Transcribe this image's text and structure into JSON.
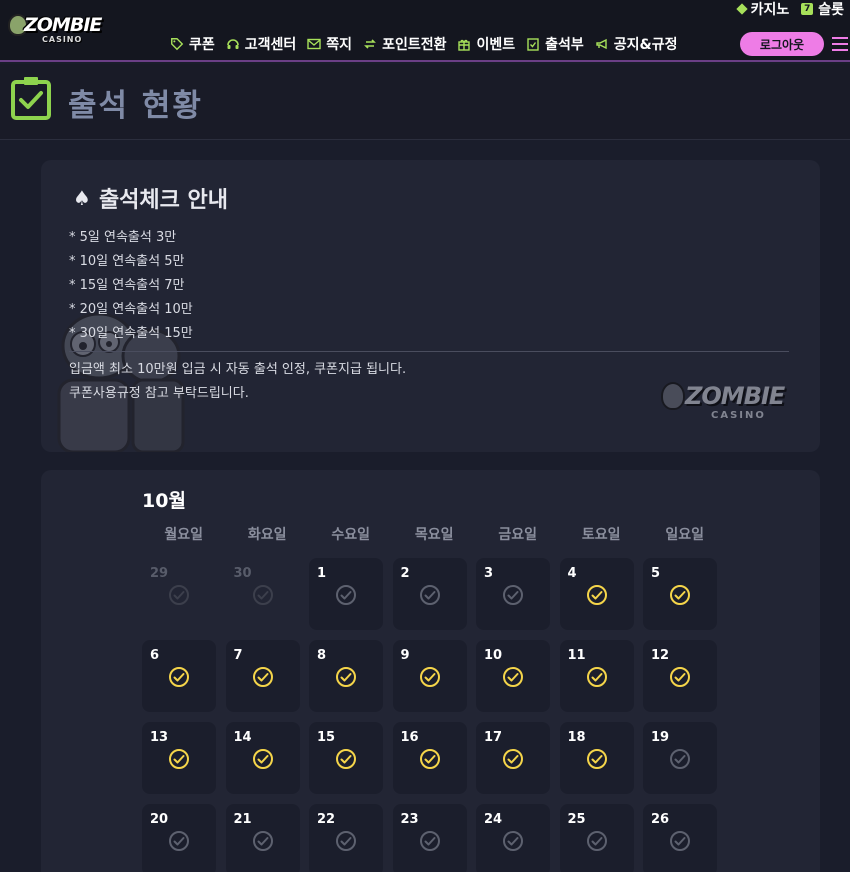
{
  "header": {
    "logo_text": "ZOMBIE",
    "logo_sub": "CASINO",
    "top_links": [
      {
        "label": "카지노",
        "icon": "diamond-icon"
      },
      {
        "label": "슬롯",
        "icon": "seven-icon"
      }
    ],
    "nav": [
      {
        "label": "쿠폰",
        "icon": "tag-icon"
      },
      {
        "label": "고객센터",
        "icon": "headset-icon"
      },
      {
        "label": "쪽지",
        "icon": "mail-icon"
      },
      {
        "label": "포인트전환",
        "icon": "exchange-icon"
      },
      {
        "label": "이벤트",
        "icon": "gift-icon"
      },
      {
        "label": "출석부",
        "icon": "check-calendar-icon"
      },
      {
        "label": "공지&규정",
        "icon": "megaphone-icon"
      }
    ],
    "logout_label": "로그아웃",
    "accent_color": "#a7e05a",
    "logout_color": "#ee7ce6"
  },
  "page": {
    "title": "출석 현황"
  },
  "info": {
    "heading": "출석체크 안내",
    "rules": [
      "* 5일 연속출석 3만",
      "* 10일 연속출석 5만",
      "* 15일 연속출석 7만",
      "* 20일 연속출석 10만",
      "* 30일 연속출석 15만"
    ],
    "notes": [
      "입금액 최소 10만원 입금 시 자동 출석 인정, 쿠폰지급 됩니다.",
      "쿠폰사용규정 참고 부탁드립니다."
    ],
    "logo_text": "ZOMBIE",
    "logo_sub": "CASINO"
  },
  "calendar": {
    "month": "10월",
    "weekdays": [
      "월요일",
      "화요일",
      "수요일",
      "목요일",
      "금요일",
      "토요일",
      "일요일"
    ],
    "checked_color": "#f5d54a",
    "unchecked_color": "#5d616f",
    "days": [
      {
        "day": "29",
        "other_month": true,
        "checked": false
      },
      {
        "day": "30",
        "other_month": true,
        "checked": false
      },
      {
        "day": "1",
        "other_month": false,
        "checked": false
      },
      {
        "day": "2",
        "other_month": false,
        "checked": false
      },
      {
        "day": "3",
        "other_month": false,
        "checked": false
      },
      {
        "day": "4",
        "other_month": false,
        "checked": true
      },
      {
        "day": "5",
        "other_month": false,
        "checked": true
      },
      {
        "day": "6",
        "other_month": false,
        "checked": true
      },
      {
        "day": "7",
        "other_month": false,
        "checked": true
      },
      {
        "day": "8",
        "other_month": false,
        "checked": true
      },
      {
        "day": "9",
        "other_month": false,
        "checked": true
      },
      {
        "day": "10",
        "other_month": false,
        "checked": true
      },
      {
        "day": "11",
        "other_month": false,
        "checked": true
      },
      {
        "day": "12",
        "other_month": false,
        "checked": true
      },
      {
        "day": "13",
        "other_month": false,
        "checked": true
      },
      {
        "day": "14",
        "other_month": false,
        "checked": true
      },
      {
        "day": "15",
        "other_month": false,
        "checked": true
      },
      {
        "day": "16",
        "other_month": false,
        "checked": true
      },
      {
        "day": "17",
        "other_month": false,
        "checked": true
      },
      {
        "day": "18",
        "other_month": false,
        "checked": true
      },
      {
        "day": "19",
        "other_month": false,
        "checked": false
      },
      {
        "day": "20",
        "other_month": false,
        "checked": false
      },
      {
        "day": "21",
        "other_month": false,
        "checked": false
      },
      {
        "day": "22",
        "other_month": false,
        "checked": false
      },
      {
        "day": "23",
        "other_month": false,
        "checked": false
      },
      {
        "day": "24",
        "other_month": false,
        "checked": false
      },
      {
        "day": "25",
        "other_month": false,
        "checked": false
      },
      {
        "day": "26",
        "other_month": false,
        "checked": false
      }
    ]
  }
}
